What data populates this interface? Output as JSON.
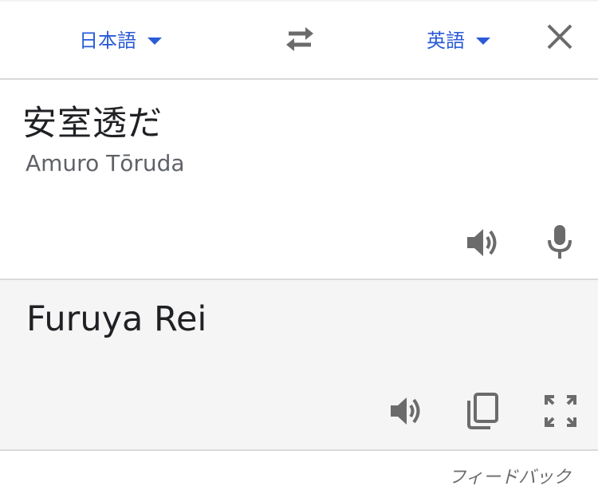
{
  "header": {
    "source_language": "日本語",
    "target_language": "英語",
    "swap_icon": "swap-arrows-icon"
  },
  "source": {
    "text": "安室透だ",
    "transliteration": "Amuro Tōruda",
    "icons": [
      "close-icon",
      "speaker-icon",
      "microphone-icon"
    ]
  },
  "result": {
    "text": "Furuya Rei",
    "icons": [
      "speaker-icon",
      "copy-icon",
      "fullscreen-icon"
    ]
  },
  "footer": {
    "feedback_label": "フィードバック"
  },
  "colors": {
    "accent": "#2a5bd7",
    "icon": "#6b6b6b",
    "result_bg": "#f5f5f5",
    "divider": "#dadada"
  }
}
